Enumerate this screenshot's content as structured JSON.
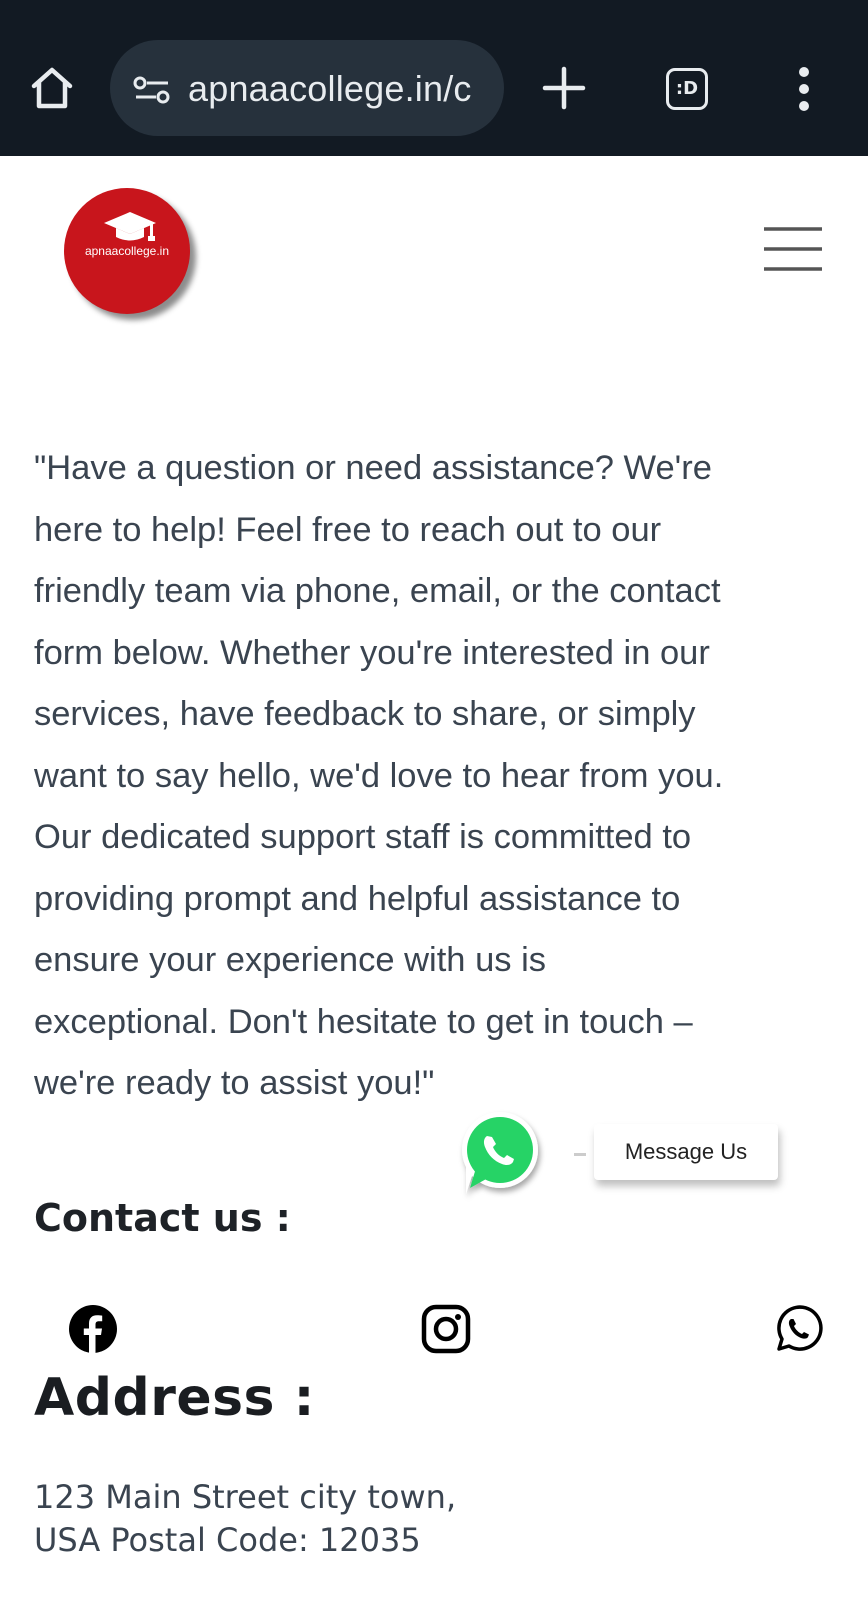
{
  "browser": {
    "url": "apnaacollege.in/c",
    "tabs_label": ":D"
  },
  "header": {
    "logo_text": "apnaacollege.in"
  },
  "intro": {
    "lines": [
      "\"Have a question or need assistance? We're",
      "here to help! Feel free to reach out to our",
      "friendly team via phone, email, or the contact",
      "form below. Whether you're interested in our",
      "services, have feedback to share, or simply",
      "want to say hello, we'd love to hear from you.",
      "Our dedicated support staff is committed to",
      "providing prompt and helpful assistance to",
      "ensure your experience with us is",
      "exceptional. Don't hesitate to get in touch –",
      "we're ready to assist you!\""
    ]
  },
  "whatsapp_widget": {
    "label": "Message Us",
    "color": "#25d366"
  },
  "contact": {
    "heading": "Contact us :",
    "icons": [
      "facebook-icon",
      "instagram-icon",
      "whatsapp-icon"
    ]
  },
  "address": {
    "heading": "Address :",
    "line1": "123 Main Street city town,",
    "line2": "USA Postal Code: 12035"
  },
  "colors": {
    "browser_bar": "#121a23",
    "url_pill": "#26313c",
    "logo_red": "#c8151c",
    "body_text": "#3a4450"
  }
}
